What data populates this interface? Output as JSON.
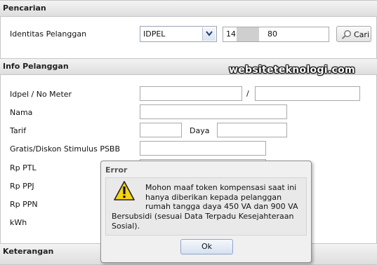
{
  "search": {
    "header": "Pencarian",
    "identity_label": "Identitas Pelanggan",
    "select_value": "IDPEL",
    "id_prefix": "14",
    "id_suffix": "80",
    "cari_button": "Cari"
  },
  "info": {
    "header": "Info Pelanggan",
    "idpel_label": "Idpel / No Meter",
    "separator": "/",
    "nama_label": "Nama",
    "tarif_label": "Tarif",
    "daya_label": "Daya",
    "gratis_label": "Gratis/Diskon Stimulus PSBB",
    "ptl_label": "Rp PTL",
    "ppj_label": "Rp PPJ",
    "ppn_label": "Rp PPN",
    "kwh_label": "kWh"
  },
  "keterangan": {
    "header": "Keterangan"
  },
  "watermark": "websiteteknologi.com",
  "dialog": {
    "title": "Error",
    "line1": "Mohon maaf token kompensasi saat ini",
    "line2": "hanya diberikan kepada pelanggan",
    "line3": "rumah tangga daya 450 VA dan 900 VA",
    "line4": "Bersubsidi (sesuai Data Terpadu Kesejahteraan",
    "line5": "Sosial).",
    "ok_button": "Ok"
  },
  "icons": {
    "dropdown": "chevron-down-icon",
    "search": "magnifier-icon",
    "warning": "warning-icon"
  }
}
